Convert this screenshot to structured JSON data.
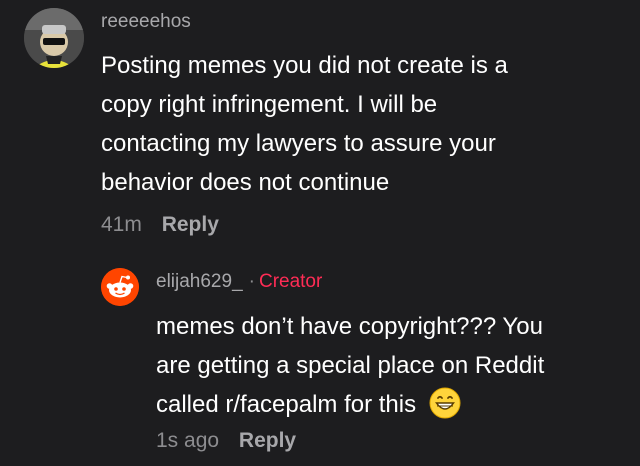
{
  "comment": {
    "author": "reeeeehos",
    "text_lines": [
      "Posting memes you did not create is a",
      "copy right infringement. I will be",
      "contacting my lawyers to assure your",
      "behavior does not continue"
    ],
    "time": "41m",
    "reply_label": "Reply"
  },
  "reply": {
    "author": "elijah629_",
    "separator": "·",
    "badge": "Creator",
    "text_lines": [
      "memes don’t have copyright??? You",
      "are getting a special place on Reddit",
      "called r/facepalm for this"
    ],
    "emoji": "grinning-face-emoji",
    "time": "1s ago",
    "reply_label": "Reply"
  },
  "colors": {
    "background": "#1d1d1f",
    "text": "#ffffff",
    "username": "#a8a8ab",
    "meta": "#8d8d90",
    "creator_badge": "#fe2c55",
    "reddit_orange": "#ff4500"
  }
}
